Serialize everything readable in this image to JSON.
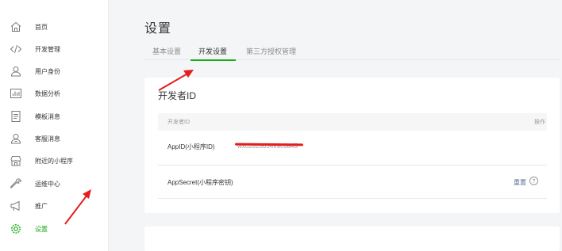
{
  "sidebar": {
    "items": [
      {
        "label": "首页",
        "icon": "home-icon"
      },
      {
        "label": "开发管理",
        "icon": "code-icon"
      },
      {
        "label": "用户身份",
        "icon": "user-icon"
      },
      {
        "label": "数据分析",
        "icon": "chart-icon"
      },
      {
        "label": "模板消息",
        "icon": "document-icon"
      },
      {
        "label": "客服消息",
        "icon": "support-icon"
      },
      {
        "label": "附近的小程序",
        "icon": "store-icon"
      },
      {
        "label": "运维中心",
        "icon": "wrench-icon"
      },
      {
        "label": "推广",
        "icon": "megaphone-icon"
      },
      {
        "label": "设置",
        "icon": "settings-icon",
        "active": true
      }
    ]
  },
  "main": {
    "title": "设置",
    "tabs": [
      {
        "label": "基本设置"
      },
      {
        "label": "开发设置",
        "active": true
      },
      {
        "label": "第三方授权管理"
      }
    ]
  },
  "developer_card": {
    "title": "开发者ID",
    "columns": {
      "name": "开发者ID",
      "action": "操作"
    },
    "rows": [
      {
        "name": "AppID(小程序ID)",
        "value": "wx02828034ff9c6a45"
      },
      {
        "name": "AppSecret(小程序密钥)",
        "action": "重置"
      }
    ]
  },
  "colors": {
    "accent": "#1aad19",
    "link": "#576b95",
    "annotation": "#e41e1e"
  }
}
